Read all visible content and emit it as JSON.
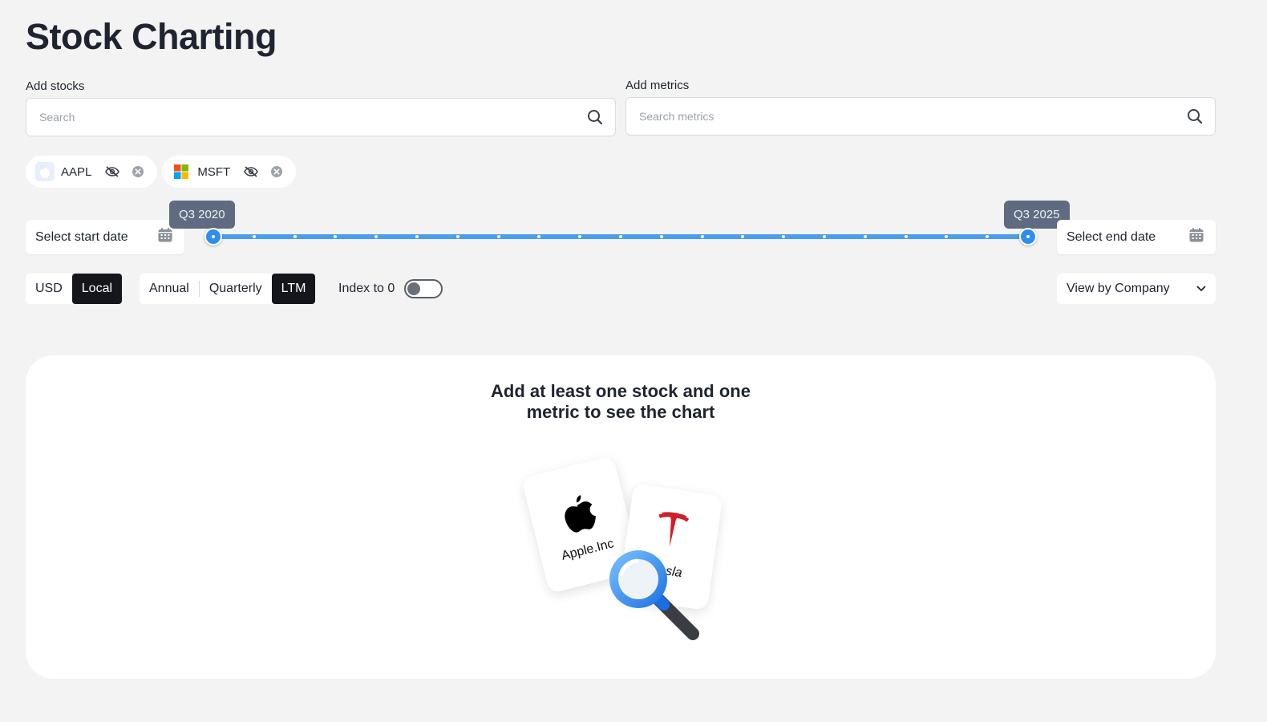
{
  "page": {
    "title": "Stock Charting"
  },
  "stocks": {
    "label": "Add stocks",
    "placeholder": "Search"
  },
  "metrics": {
    "label": "Add metrics",
    "placeholder": "Search metrics"
  },
  "chips": [
    {
      "ticker": "AAPL",
      "logo": "apple-logo-icon"
    },
    {
      "ticker": "MSFT",
      "logo": "microsoft-logo-icon"
    }
  ],
  "dates": {
    "start_label": "Select start date",
    "end_label": "Select end date",
    "range_start": "Q3 2020",
    "range_end": "Q3 2025"
  },
  "currency": {
    "options": [
      "USD",
      "Local"
    ],
    "selected": "Local"
  },
  "period": {
    "options": [
      "Annual",
      "Quarterly",
      "LTM"
    ],
    "selected": "LTM"
  },
  "index_toggle": {
    "label": "Index to 0",
    "on": false
  },
  "view": {
    "selected": "View by Company"
  },
  "empty_state": {
    "line1": "Add at least one stock and one",
    "line2": "metric to see the chart",
    "card1": "Apple.Inc",
    "card2": "Tesla"
  },
  "colors": {
    "accent": "#2d8ef0",
    "dark": "#15161b",
    "tesla_red": "#cc1f2b"
  }
}
